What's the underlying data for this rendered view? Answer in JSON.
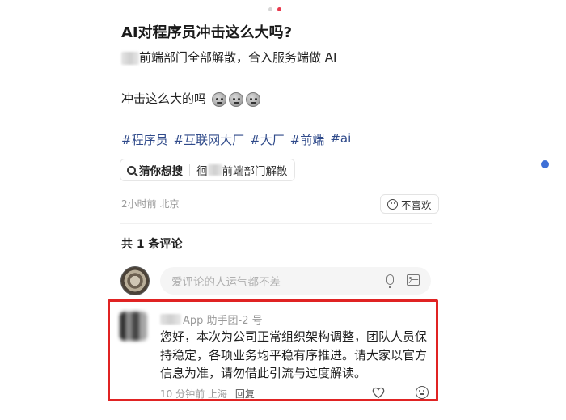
{
  "post": {
    "title": "AI对程序员冲击这么大吗?",
    "line1_rest": "前端部门全部解散，合入服务端做 AI",
    "line2": "冲击这么大的吗",
    "tags": [
      "#程序员",
      "#互联网大厂",
      "#大厂",
      "#前端",
      "#ai"
    ],
    "guess_label": "猜你想搜",
    "guess_query_prefix": "徊",
    "guess_query_rest": "前端部门解散",
    "meta": "2小时前 北京",
    "dislike_label": "不喜欢"
  },
  "comments": {
    "count_label": "共 1 条评论",
    "input_placeholder": "爱评论的人运气都不差",
    "items": [
      {
        "author_suffix": "App 助手团-2 号",
        "text": "您好，本次为公司正常组织架构调整，团队人员保持稳定，各项业务均平稳有序推进。请大家以官方信息为准，请勿借此引流与过度解读。",
        "meta": "10 分钟前 上海",
        "reply_label": "回复"
      }
    ]
  },
  "colors": {
    "tag": "#2f4a8a",
    "highlight": "#e02323",
    "pager_active": "#e8394d",
    "side_dot": "#3e6fd6"
  },
  "icons": [
    "search-icon",
    "dislike-face-icon",
    "microphone-icon",
    "image-icon",
    "heart-icon",
    "emoji-icon"
  ],
  "pager": {
    "count": 2,
    "active": 2
  }
}
